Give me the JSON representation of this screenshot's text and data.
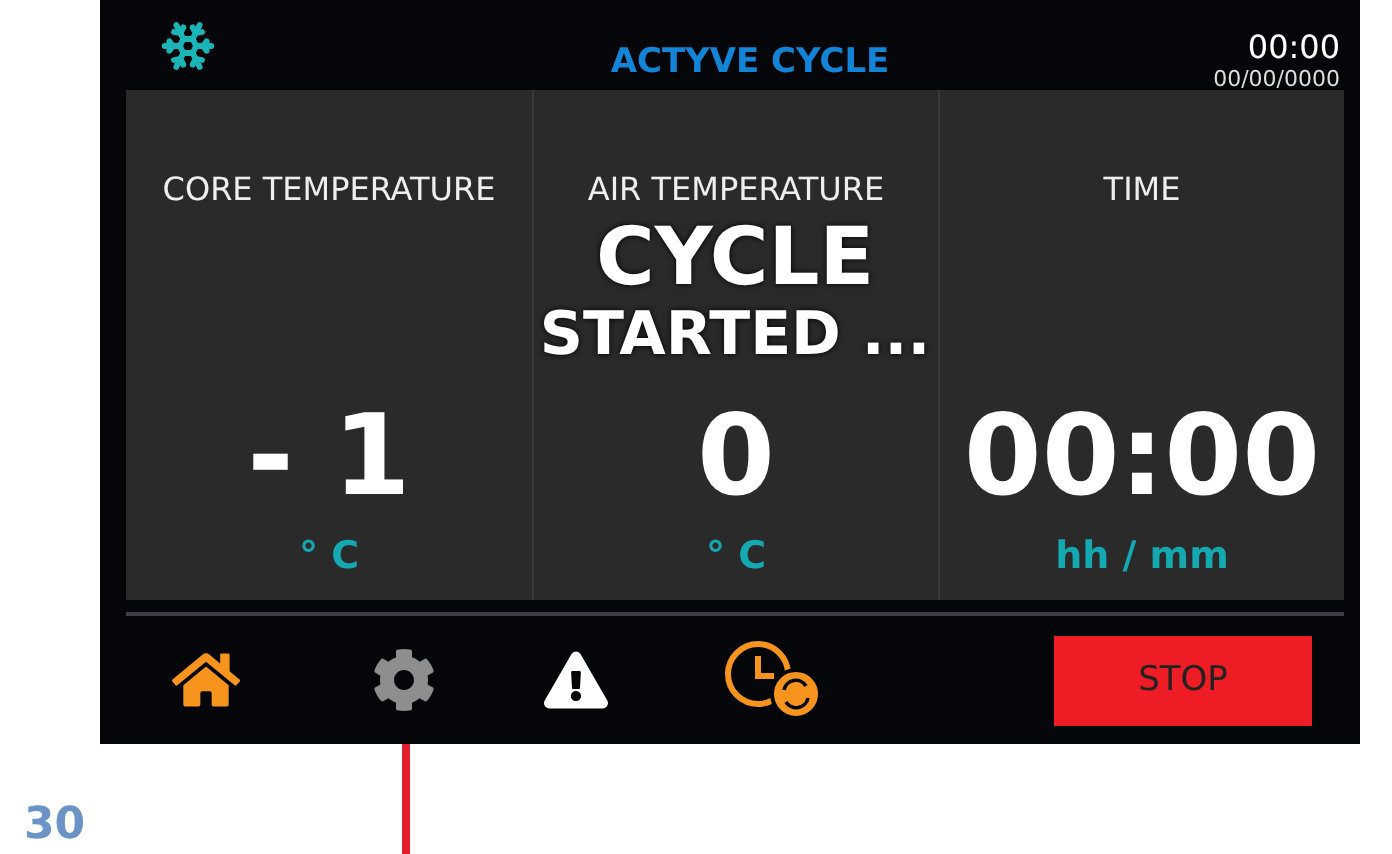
{
  "header": {
    "title": "ACTYVE CYCLE",
    "time": "00:00",
    "date": "00/00/0000"
  },
  "readouts": [
    {
      "label": "CORE TEMPERATURE",
      "value": "- 1",
      "unit": "° C"
    },
    {
      "label": "AIR TEMPERATURE",
      "value": "0",
      "unit": "° C"
    },
    {
      "label": "TIME",
      "value": "00:00",
      "unit": "hh / mm"
    }
  ],
  "message": {
    "lines": [
      "CYCLE",
      "STARTED ..."
    ]
  },
  "toolbar": {
    "stop_button": "STOP"
  },
  "page_number": "30"
}
